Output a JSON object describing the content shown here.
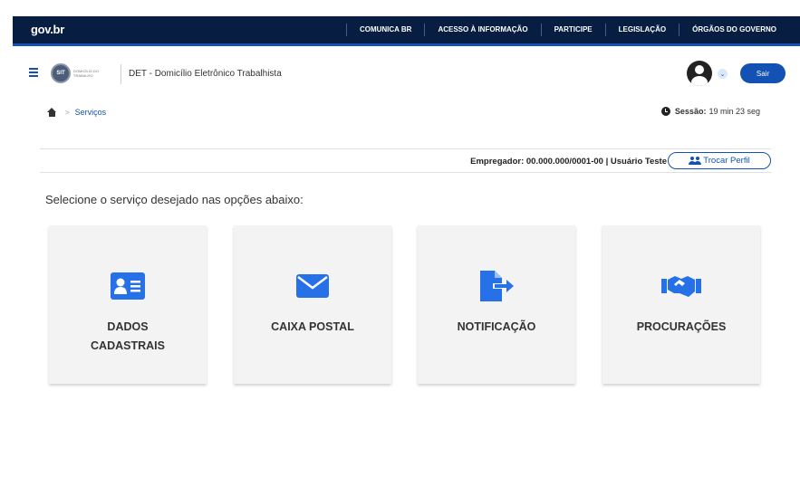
{
  "gov_bar": {
    "logo": "gov.br",
    "links": [
      {
        "label": "COMUNICA BR"
      },
      {
        "label": "ACESSO À INFORMAÇÃO"
      },
      {
        "label": "PARTICIPE"
      },
      {
        "label": "LEGISLAÇÃO"
      },
      {
        "label": "ÓRGÃOS DO GOVERNO"
      }
    ]
  },
  "header": {
    "logo_badge": "SIT",
    "logo_subtitle": "DOMICÍLIO DO TRABALHO",
    "app_title": "DET - Domicílio Eletrônico Trabalhista",
    "logout_label": "Sair",
    "avatar_chevron": "⌄"
  },
  "breadcrumb": {
    "separator": ">",
    "current": "Serviços"
  },
  "session": {
    "label": "Sessão:",
    "time": "19 min 23 seg"
  },
  "profile": {
    "employer_text": "Empregador: 00.000.000/0001-00 | Usuário Teste",
    "switch_label": "Trocar Perfil"
  },
  "main": {
    "instruction": "Selecione o serviço desejado nas opções abaixo:",
    "cards": [
      {
        "label": "DADOS CADASTRAIS",
        "icon": "id-card-icon"
      },
      {
        "label": "CAIXA POSTAL",
        "icon": "envelope-icon"
      },
      {
        "label": "NOTIFICAÇÃO",
        "icon": "file-export-icon"
      },
      {
        "label": "PROCURAÇÕES",
        "icon": "handshake-icon"
      }
    ]
  },
  "colors": {
    "gov_navy": "#071d41",
    "primary_blue": "#1351b4",
    "card_bg": "#f3f3f3",
    "icon_blue": "#2670e8"
  }
}
